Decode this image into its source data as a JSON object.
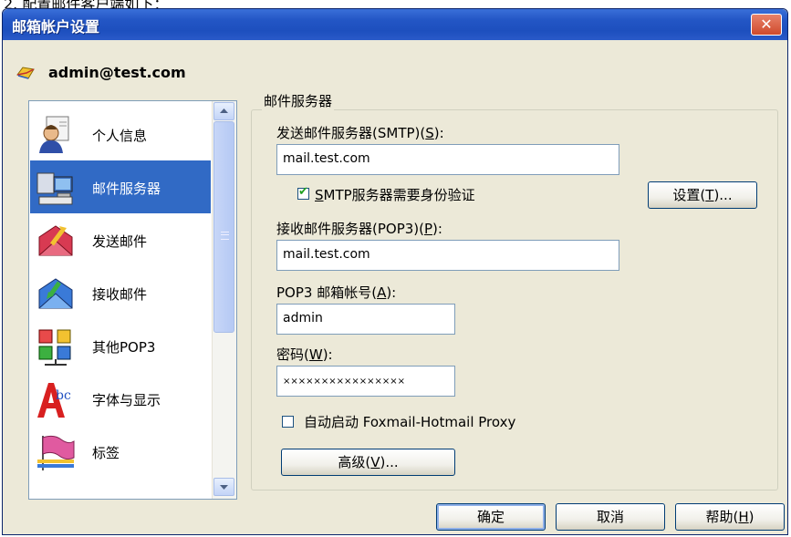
{
  "page_caption": "2. 配置邮件客户端如下：",
  "window": {
    "title": "邮箱帐户设置",
    "close_glyph": "✕"
  },
  "account": {
    "email": "admin@test.com"
  },
  "nav": {
    "items": [
      {
        "label": "个人信息",
        "icon": "person-icon",
        "selected": false
      },
      {
        "label": "邮件服务器",
        "icon": "server-icon",
        "selected": true
      },
      {
        "label": "发送邮件",
        "icon": "send-mail-icon",
        "selected": false
      },
      {
        "label": "接收邮件",
        "icon": "receive-mail-icon",
        "selected": false
      },
      {
        "label": "其他POP3",
        "icon": "network-icon",
        "selected": false
      },
      {
        "label": "字体与显示",
        "icon": "font-icon",
        "selected": false
      },
      {
        "label": "标签",
        "icon": "flag-icon",
        "selected": false
      }
    ]
  },
  "server": {
    "group_title": "邮件服务器",
    "smtp_label_prefix": "发送邮件服务器(SMTP)(",
    "smtp_label_key": "S",
    "smtp_label_suffix": "):",
    "smtp_value": "mail.test.com",
    "auth_checkbox_key": "S",
    "auth_checkbox_rest": "MTP服务器需要身份验证",
    "auth_checked": true,
    "settings_btn_prefix": "设置(",
    "settings_btn_key": "T",
    "settings_btn_suffix": ")...",
    "pop3_label_prefix": "接收邮件服务器(POP3)(",
    "pop3_label_key": "P",
    "pop3_label_suffix": "):",
    "pop3_value": "mail.test.com",
    "account_label_prefix": "POP3 邮箱帐号(",
    "account_label_key": "A",
    "account_label_suffix": "):",
    "account_value": "admin",
    "password_label_prefix": "密码(",
    "password_label_key": "W",
    "password_label_suffix": "):",
    "password_value": "××××××××××××××××",
    "proxy_checkbox_label": "自动启动 Foxmail-Hotmail Proxy",
    "proxy_checked": false,
    "advanced_btn_prefix": "高级(",
    "advanced_btn_key": "V",
    "advanced_btn_suffix": ")..."
  },
  "footer": {
    "ok_label": "确定",
    "cancel_label": "取消",
    "help_prefix": "帮助(",
    "help_key": "H",
    "help_suffix": ")"
  },
  "colors": {
    "titlebar": "#2356c5",
    "selection": "#316ac5",
    "dialog_bg": "#ece9d8"
  }
}
